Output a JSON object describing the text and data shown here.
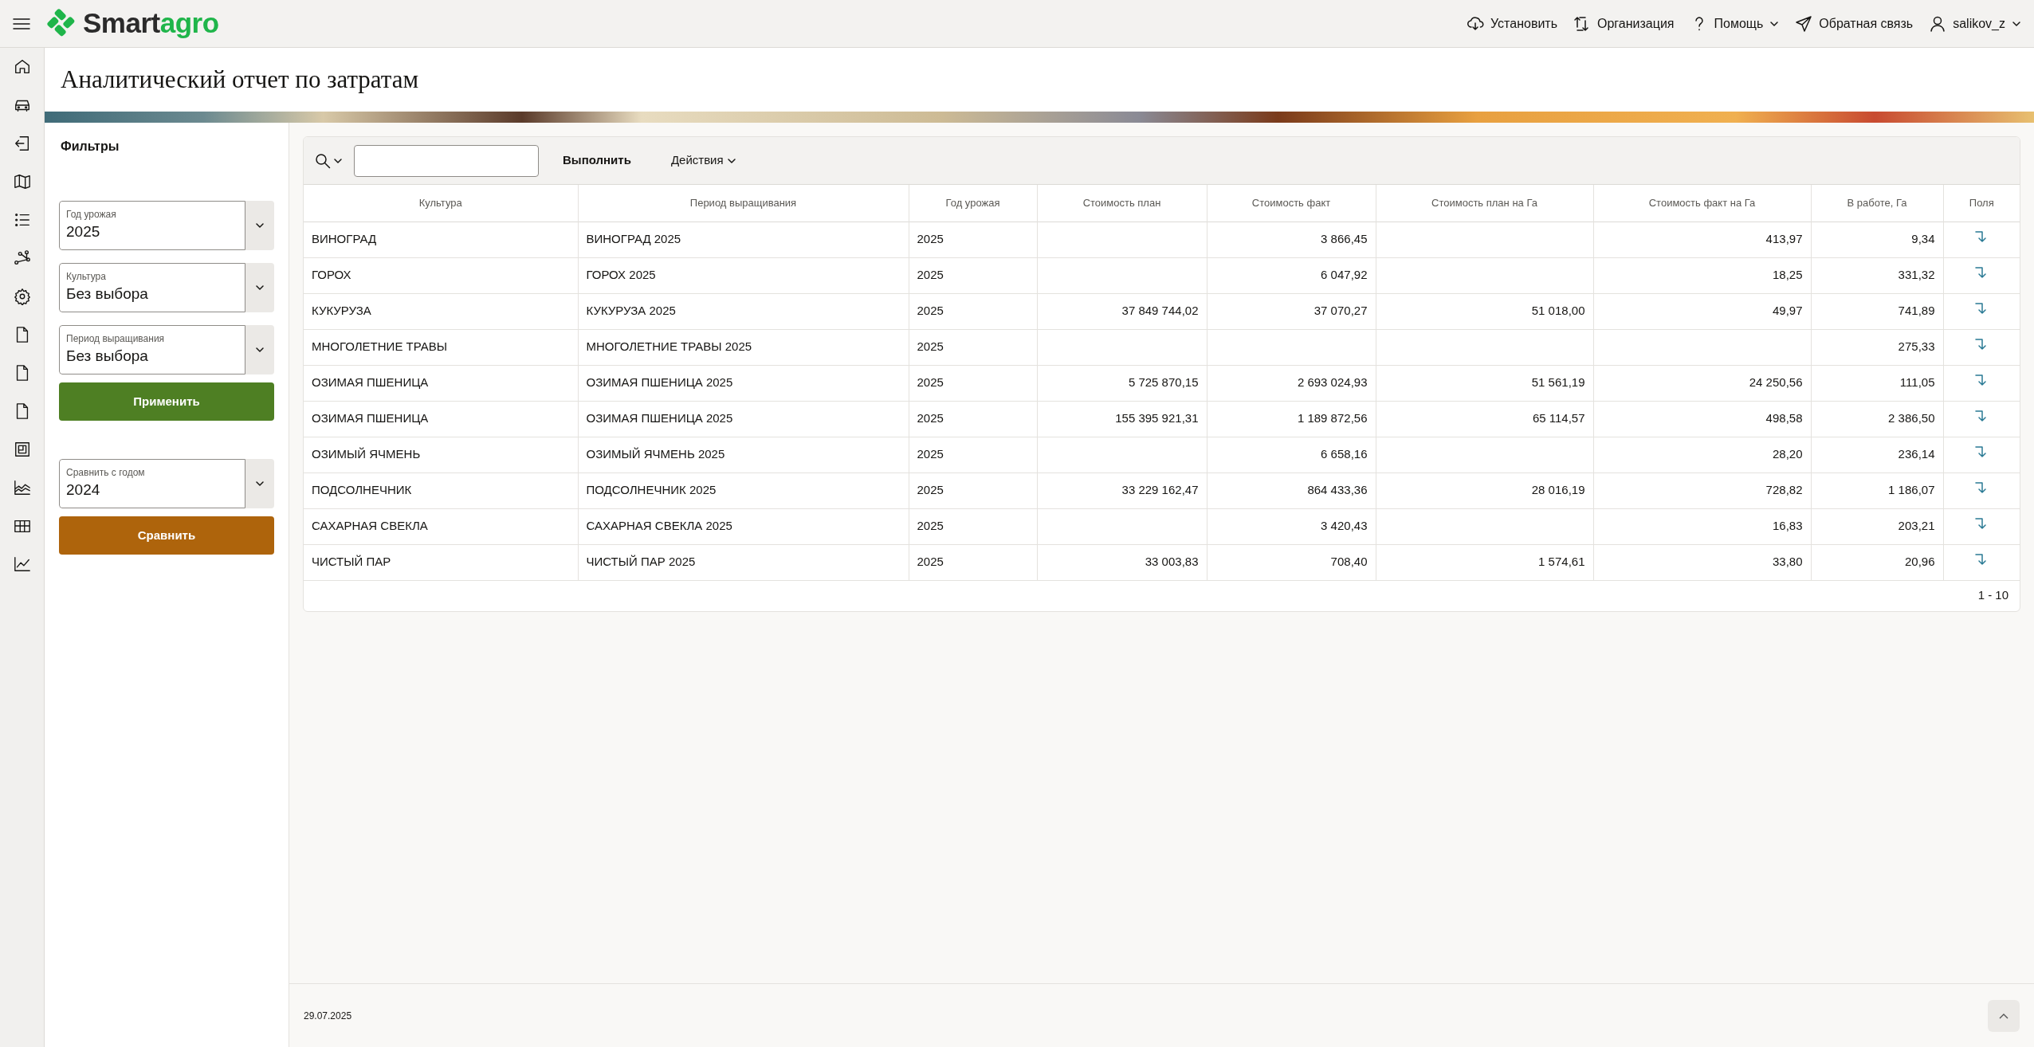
{
  "header": {
    "logo": {
      "dark": "Smart",
      "accent": "agro"
    },
    "menu": [
      {
        "label": "Установить",
        "has_menu": false
      },
      {
        "label": "Организация",
        "has_menu": false
      },
      {
        "label": "Помощь",
        "has_menu": true
      },
      {
        "label": "Обратная связь",
        "has_menu": false
      },
      {
        "label": "salikov_z",
        "has_menu": true
      }
    ]
  },
  "page_title": "Аналитический отчет по затратам",
  "filters": {
    "title": "Фильтры",
    "items": [
      {
        "kind": "select",
        "label": "Год урожая",
        "value": "2025"
      },
      {
        "kind": "select",
        "label": "Культура",
        "value": "Без выбора"
      },
      {
        "kind": "select",
        "label": "Период выращивания",
        "value": "Без выбора"
      },
      {
        "kind": "button",
        "label": "Применить",
        "color": "#4e7f23"
      },
      {
        "kind": "spacer"
      },
      {
        "kind": "select",
        "label": "Сравнить с годом",
        "value": "2024"
      },
      {
        "kind": "button",
        "label": "Сравнить",
        "color": "#ae640c"
      }
    ]
  },
  "report": {
    "toolbar": {
      "run": "Выполнить",
      "actions": "Действия"
    },
    "columns": [
      {
        "label": "Культура",
        "kind": "text"
      },
      {
        "label": "Период выращивания",
        "kind": "text"
      },
      {
        "label": "Год урожая",
        "kind": "text"
      },
      {
        "label": "Стоимость план",
        "kind": "number"
      },
      {
        "label": "Стоимость факт",
        "kind": "number"
      },
      {
        "label": "Стоимость план на Га",
        "kind": "number"
      },
      {
        "label": "Стоимость факт на Га",
        "kind": "number"
      },
      {
        "label": "В работе, Га",
        "kind": "number"
      },
      {
        "label": "Поля",
        "kind": "link"
      }
    ],
    "rows": [
      [
        "ВИНОГРАД",
        "ВИНОГРАД 2025",
        "2025",
        null,
        "3 866,45",
        null,
        "413,97",
        "9,34"
      ],
      [
        "ГОРОХ",
        "ГОРОХ 2025",
        "2025",
        null,
        "6 047,92",
        null,
        "18,25",
        "331,32"
      ],
      [
        "КУКУРУЗА",
        "КУКУРУЗА 2025",
        "2025",
        "37 849 744,02",
        "37 070,27",
        "51 018,00",
        "49,97",
        "741,89"
      ],
      [
        "МНОГОЛЕТНИЕ ТРАВЫ",
        "МНОГОЛЕТНИЕ ТРАВЫ 2025",
        "2025",
        null,
        null,
        null,
        null,
        "275,33"
      ],
      [
        "ОЗИМАЯ ПШЕНИЦА",
        "ОЗИМАЯ ПШЕНИЦА 2025",
        "2025",
        "5 725 870,15",
        "2 693 024,93",
        "51 561,19",
        "24 250,56",
        "111,05"
      ],
      [
        "ОЗИМАЯ ПШЕНИЦА",
        "ОЗИМАЯ ПШЕНИЦА 2025",
        "2025",
        "155 395 921,31",
        "1 189 872,56",
        "65 114,57",
        "498,58",
        "2 386,50"
      ],
      [
        "ОЗИМЫЙ ЯЧМЕНЬ",
        "ОЗИМЫЙ ЯЧМЕНЬ 2025",
        "2025",
        null,
        "6 658,16",
        null,
        "28,20",
        "236,14"
      ],
      [
        "ПОДСОЛНЕЧНИК",
        "ПОДСОЛНЕЧНИК 2025",
        "2025",
        "33 229 162,47",
        "864 433,36",
        "28 016,19",
        "728,82",
        "1 186,07"
      ],
      [
        "САХАРНАЯ СВЕКЛА",
        "САХАРНАЯ СВЕКЛА 2025",
        "2025",
        null,
        "3 420,43",
        null,
        "16,83",
        "203,21"
      ],
      [
        "ЧИСТЫЙ ПАР",
        "ЧИСТЫЙ ПАР 2025",
        "2025",
        "33 003,83",
        "708,40",
        "1 574,61",
        "33,80",
        "20,96"
      ]
    ],
    "pagination": "1 - 10"
  },
  "footer": {
    "date": "29.07.2025"
  }
}
